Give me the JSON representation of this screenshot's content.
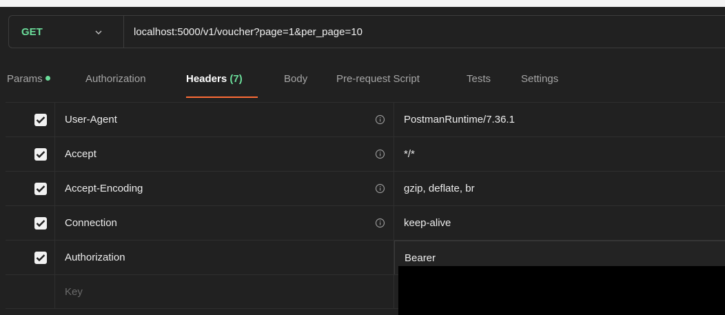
{
  "request": {
    "method": "GET",
    "url": "localhost:5000/v1/voucher?page=1&per_page=10"
  },
  "tabs": [
    {
      "label": "Params",
      "has_dot": true
    },
    {
      "label": "Authorization"
    },
    {
      "label": "Headers",
      "count": "(7)",
      "active": true
    },
    {
      "label": "Body"
    },
    {
      "label": "Pre-request Script"
    },
    {
      "label": "Tests"
    },
    {
      "label": "Settings"
    }
  ],
  "headers": [
    {
      "key": "User-Agent",
      "value": "PostmanRuntime/7.36.1",
      "checked": true,
      "info_icon": true
    },
    {
      "key": "Accept",
      "value": "*/*",
      "checked": true,
      "info_icon": true
    },
    {
      "key": "Accept-Encoding",
      "value": "gzip, deflate, br",
      "checked": true,
      "info_icon": true
    },
    {
      "key": "Connection",
      "value": "keep-alive",
      "checked": true,
      "info_icon": true
    },
    {
      "key": "Authorization",
      "value": "Bearer",
      "checked": true,
      "info_icon": false
    }
  ],
  "new_row": {
    "key_placeholder": "Key"
  },
  "colors": {
    "background": "#212121",
    "method_get": "#6bdd9a",
    "active_tab_underline": "#ff6c37",
    "redaction": "#000000"
  }
}
